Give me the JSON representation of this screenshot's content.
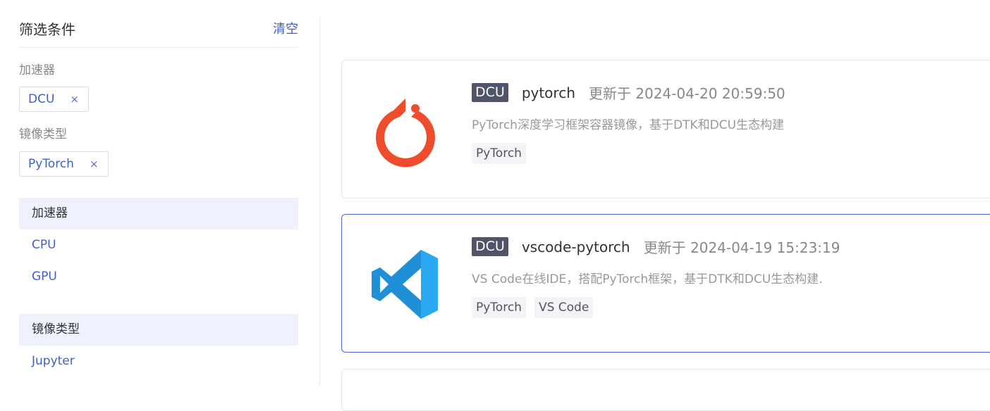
{
  "filters": {
    "title": "筛选条件",
    "clear_label": "清空",
    "groups": [
      {
        "label": "加速器",
        "chip": "DCU",
        "chip_close": "×"
      },
      {
        "label": "镜像类型",
        "chip": "PyTorch",
        "chip_close": "×"
      }
    ],
    "categories": [
      {
        "header": "加速器",
        "items": [
          "CPU",
          "GPU"
        ]
      },
      {
        "header": "镜像类型",
        "items": [
          "Jupyter"
        ]
      }
    ]
  },
  "images": [
    {
      "badge": "DCU",
      "name": "pytorch",
      "updated": "更新于 2024-04-20 20:59:50",
      "description": "PyTorch深度学习框架容器镜像，基于DTK和DCU生态构建",
      "tags": [
        "PyTorch"
      ],
      "icon": "pytorch-logo-icon",
      "icon_color": "#ee4c2c"
    },
    {
      "badge": "DCU",
      "name": "vscode-pytorch",
      "updated": "更新于 2024-04-19 15:23:19",
      "description": "VS Code在线IDE，搭配PyTorch框架，基于DTK和DCU生态构建.",
      "tags": [
        "PyTorch",
        "VS Code"
      ],
      "icon": "vscode-logo-icon",
      "icon_color": "#23a9f2"
    }
  ],
  "colors": {
    "accent": "#3f5fd1",
    "badge_bg": "#505468",
    "category_bg": "#eff2fd",
    "active_border": "#4f67d6"
  }
}
